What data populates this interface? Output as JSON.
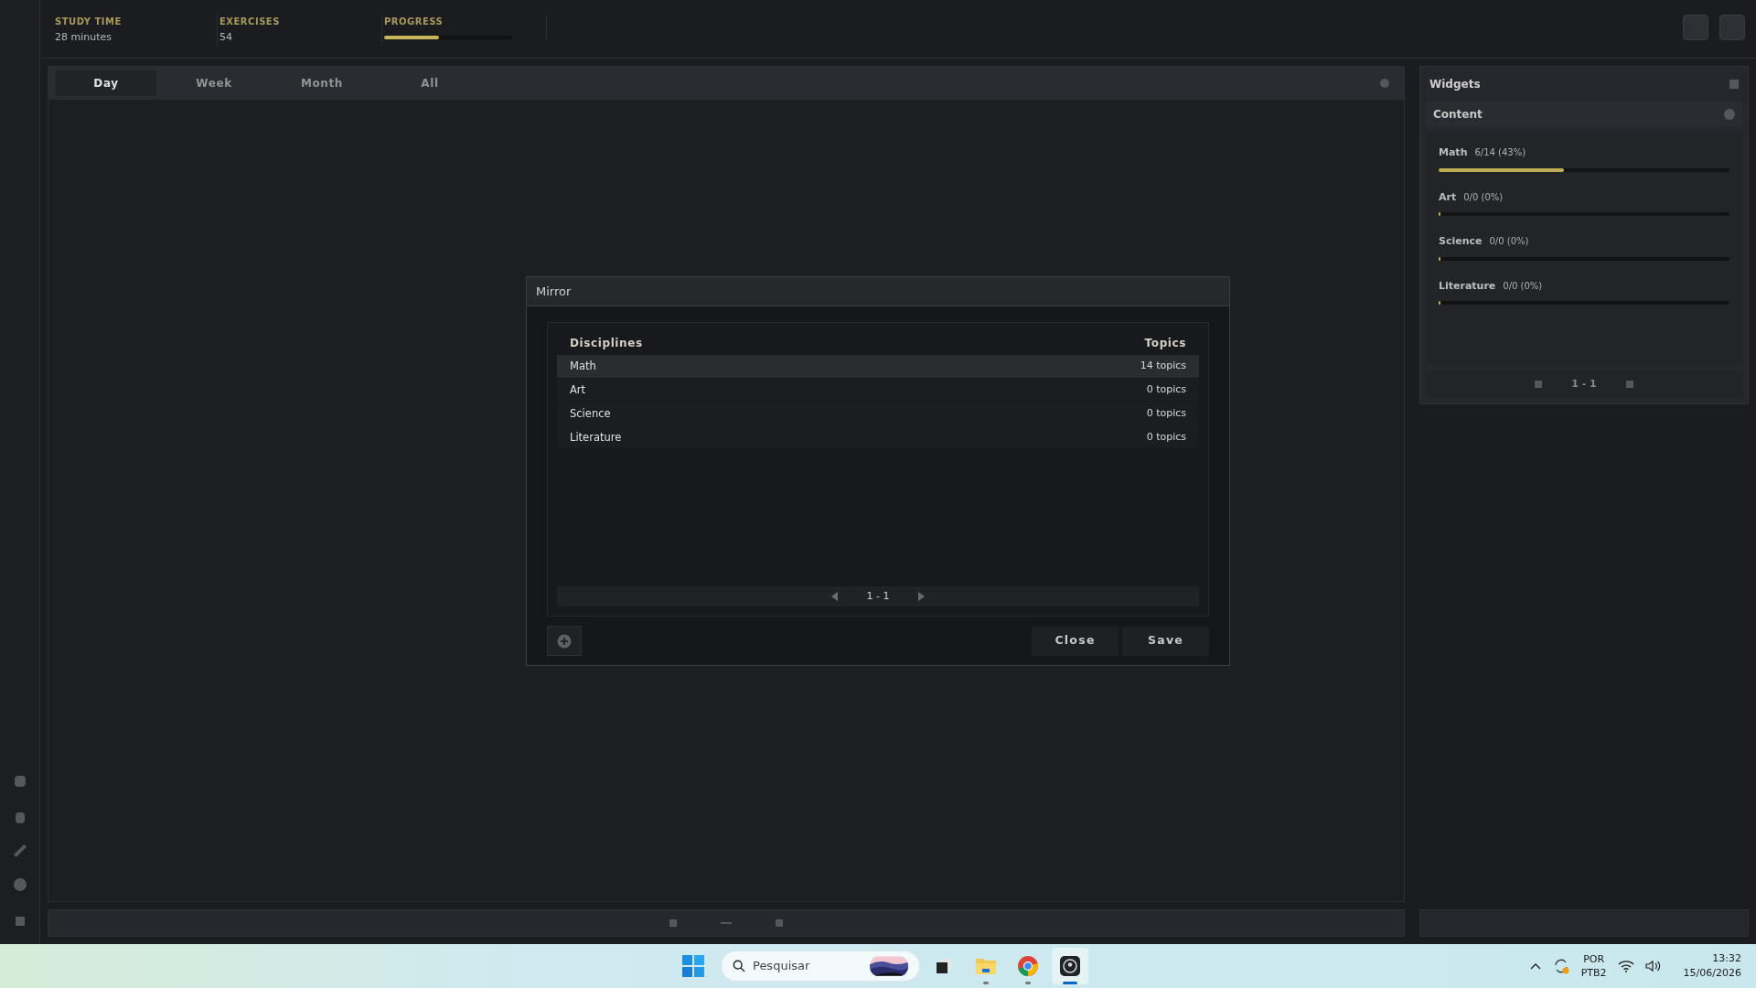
{
  "stats": [
    {
      "kind": "text",
      "label": "STUDY TIME",
      "value": "28 minutes"
    },
    {
      "kind": "text",
      "label": "EXERCISES",
      "value": "54"
    },
    {
      "kind": "bar",
      "label": "PROGRESS",
      "level": 0.43
    }
  ],
  "tabs": [
    {
      "label": "Day",
      "selected": true
    },
    {
      "label": "Week",
      "selected": false
    },
    {
      "label": "Month",
      "selected": false
    },
    {
      "label": "All",
      "selected": false
    }
  ],
  "widgets": {
    "title": "Widgets",
    "section": "Content",
    "items": [
      {
        "name": "Math",
        "reading": "6/14 (43%)",
        "level": 0.43
      },
      {
        "name": "Art",
        "reading": "0/0 (0%)",
        "level": 0
      },
      {
        "name": "Science",
        "reading": "0/0 (0%)",
        "level": 0
      },
      {
        "name": "Literature",
        "reading": "0/0 (0%)",
        "level": 0
      }
    ],
    "pager": "1 - 1"
  },
  "dialog": {
    "title": "Mirror",
    "columns": [
      "Disciplines",
      "Topics"
    ],
    "rows": [
      {
        "name": "Math",
        "topics": "14 topics",
        "selected": true
      },
      {
        "name": "Art",
        "topics": "0 topics",
        "selected": false
      },
      {
        "name": "Science",
        "topics": "0 topics",
        "selected": false
      },
      {
        "name": "Literature",
        "topics": "0 topics",
        "selected": false
      }
    ],
    "pager": "1 - 1",
    "buttons": [
      "Close",
      "Save"
    ]
  },
  "taskbar": {
    "search": {
      "placeholder": "Pesquisar"
    },
    "apps": [
      {
        "kind": "taskview",
        "running": false,
        "selected": false
      },
      {
        "kind": "folder",
        "running": true,
        "selected": false
      },
      {
        "kind": "browser",
        "running": true,
        "selected": false
      },
      {
        "kind": "app",
        "running": true,
        "selected": true
      }
    ],
    "language": "POR",
    "layout": "PTB2",
    "time": "13:32",
    "date": "15/06/2026"
  }
}
